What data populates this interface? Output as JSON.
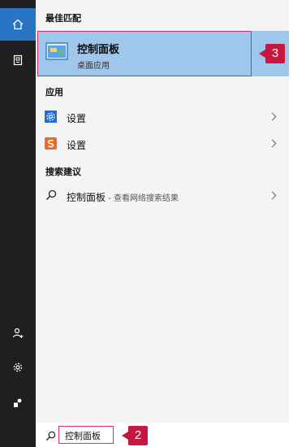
{
  "best_match": {
    "section": "最佳匹配",
    "title": "控制面板",
    "subtitle": "桌面应用",
    "badge": "3"
  },
  "apps": {
    "section": "应用",
    "items": [
      {
        "label": "设置",
        "icon": "gear-settings-icon",
        "color": "#1f6fd1"
      },
      {
        "label": "设置",
        "icon": "sogou-s-icon",
        "color": "#f06a24"
      }
    ]
  },
  "suggestions": {
    "section": "搜索建议",
    "items": [
      {
        "label": "控制面板",
        "sub": " - 查看网络搜索结果"
      }
    ]
  },
  "search": {
    "value": "控制面板",
    "badge": "2"
  },
  "colors": {
    "accent": "#2a74c5",
    "highlight": "#9fc7ec",
    "badge": "#c8173f",
    "border": "#d72a6f"
  }
}
